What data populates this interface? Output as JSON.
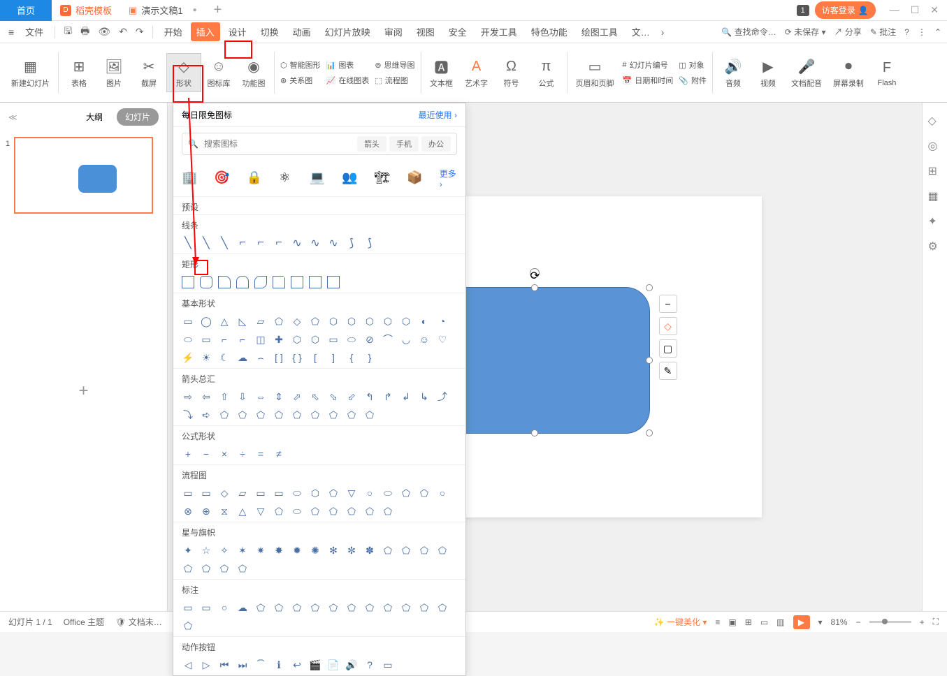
{
  "titlebar": {
    "home": "首页",
    "daoke": "稻壳模板",
    "doc": "演示文稿1",
    "badge": "1",
    "guest": "访客登录"
  },
  "menubar": {
    "file": "文件",
    "items": [
      "开始",
      "插入",
      "设计",
      "切换",
      "动画",
      "幻灯片放映",
      "审阅",
      "视图",
      "安全",
      "开发工具",
      "特色功能",
      "绘图工具",
      "文…"
    ],
    "search": "查找命令…",
    "unsaved": "未保存",
    "share": "分享",
    "batch": "批注"
  },
  "ribbon": {
    "newSlide": "新建幻灯片",
    "table": "表格",
    "picture": "图片",
    "screenshot": "截屏",
    "shape": "形状",
    "iconLib": "图标库",
    "funcChart": "功能图",
    "smartArt": "智能图形",
    "chart": "图表",
    "relChart": "关系图",
    "onlineChart": "在线图表",
    "mindMap": "思维导图",
    "flowchart": "流程图",
    "textBox": "文本框",
    "wordArt": "艺术字",
    "symbol": "符号",
    "equation": "公式",
    "headerFooter": "页眉和页脚",
    "slideNum": "幻灯片编号",
    "dateTime": "日期和时间",
    "object": "对象",
    "attach": "附件",
    "audio": "音频",
    "video": "视频",
    "docAudio": "文档配音",
    "screenRec": "屏幕录制",
    "flash": "Flash"
  },
  "slidePanel": {
    "outline": "大纲",
    "slides": "幻灯片",
    "num": "1"
  },
  "dropdown": {
    "header": "每日限免图标",
    "recent": "最近使用",
    "searchPlaceholder": "搜索图标",
    "tags": [
      "箭头",
      "手机",
      "办公"
    ],
    "more": "更多",
    "sections": {
      "preset": "预设",
      "line": "线条",
      "rect": "矩形",
      "basic": "基本形状",
      "arrows": "箭头总汇",
      "formula": "公式形状",
      "flowchart": "流程图",
      "stars": "星与旗帜",
      "callouts": "标注",
      "actions": "动作按钮"
    }
  },
  "statusbar": {
    "slideCount": "幻灯片 1 / 1",
    "theme": "Office 主题",
    "docProtect": "文档未…",
    "beautify": "一键美化",
    "zoom": "81%"
  }
}
